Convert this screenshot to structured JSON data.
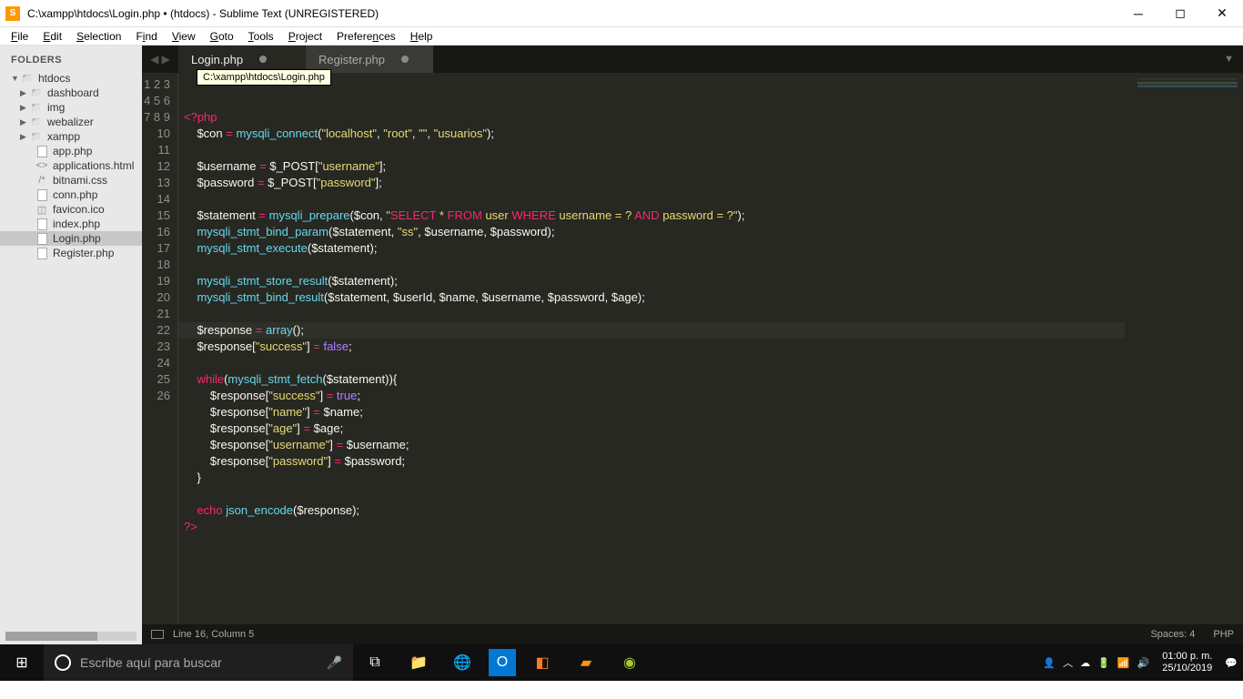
{
  "window": {
    "title": "C:\\xampp\\htdocs\\Login.php • (htdocs) - Sublime Text (UNREGISTERED)"
  },
  "menu": [
    "File",
    "Edit",
    "Selection",
    "Find",
    "View",
    "Goto",
    "Tools",
    "Project",
    "Preferences",
    "Help"
  ],
  "sidebar": {
    "header": "FOLDERS",
    "root": "htdocs",
    "folders": [
      "dashboard",
      "img",
      "webalizer",
      "xampp"
    ],
    "files": [
      {
        "name": "app.php",
        "icon": "file"
      },
      {
        "name": "applications.html",
        "icon": "code"
      },
      {
        "name": "bitnami.css",
        "icon": "css"
      },
      {
        "name": "conn.php",
        "icon": "file"
      },
      {
        "name": "favicon.ico",
        "icon": "img"
      },
      {
        "name": "index.php",
        "icon": "file"
      },
      {
        "name": "Login.php",
        "icon": "file",
        "selected": true
      },
      {
        "name": "Register.php",
        "icon": "file"
      }
    ]
  },
  "tabs": [
    {
      "label": "Login.php",
      "active": true,
      "dirty": true
    },
    {
      "label": "Register.php",
      "active": false,
      "dirty": true
    }
  ],
  "tooltip": "C:\\xampp\\htdocs\\Login.php",
  "statusbar": {
    "position": "Line 16, Column 5",
    "spaces": "Spaces: 4",
    "syntax": "PHP"
  },
  "taskbar": {
    "search_placeholder": "Escribe aquí para buscar",
    "time": "01:00 p. m.",
    "date": "25/10/2019"
  },
  "code": {
    "lines": 26,
    "cursor_line": 16
  }
}
